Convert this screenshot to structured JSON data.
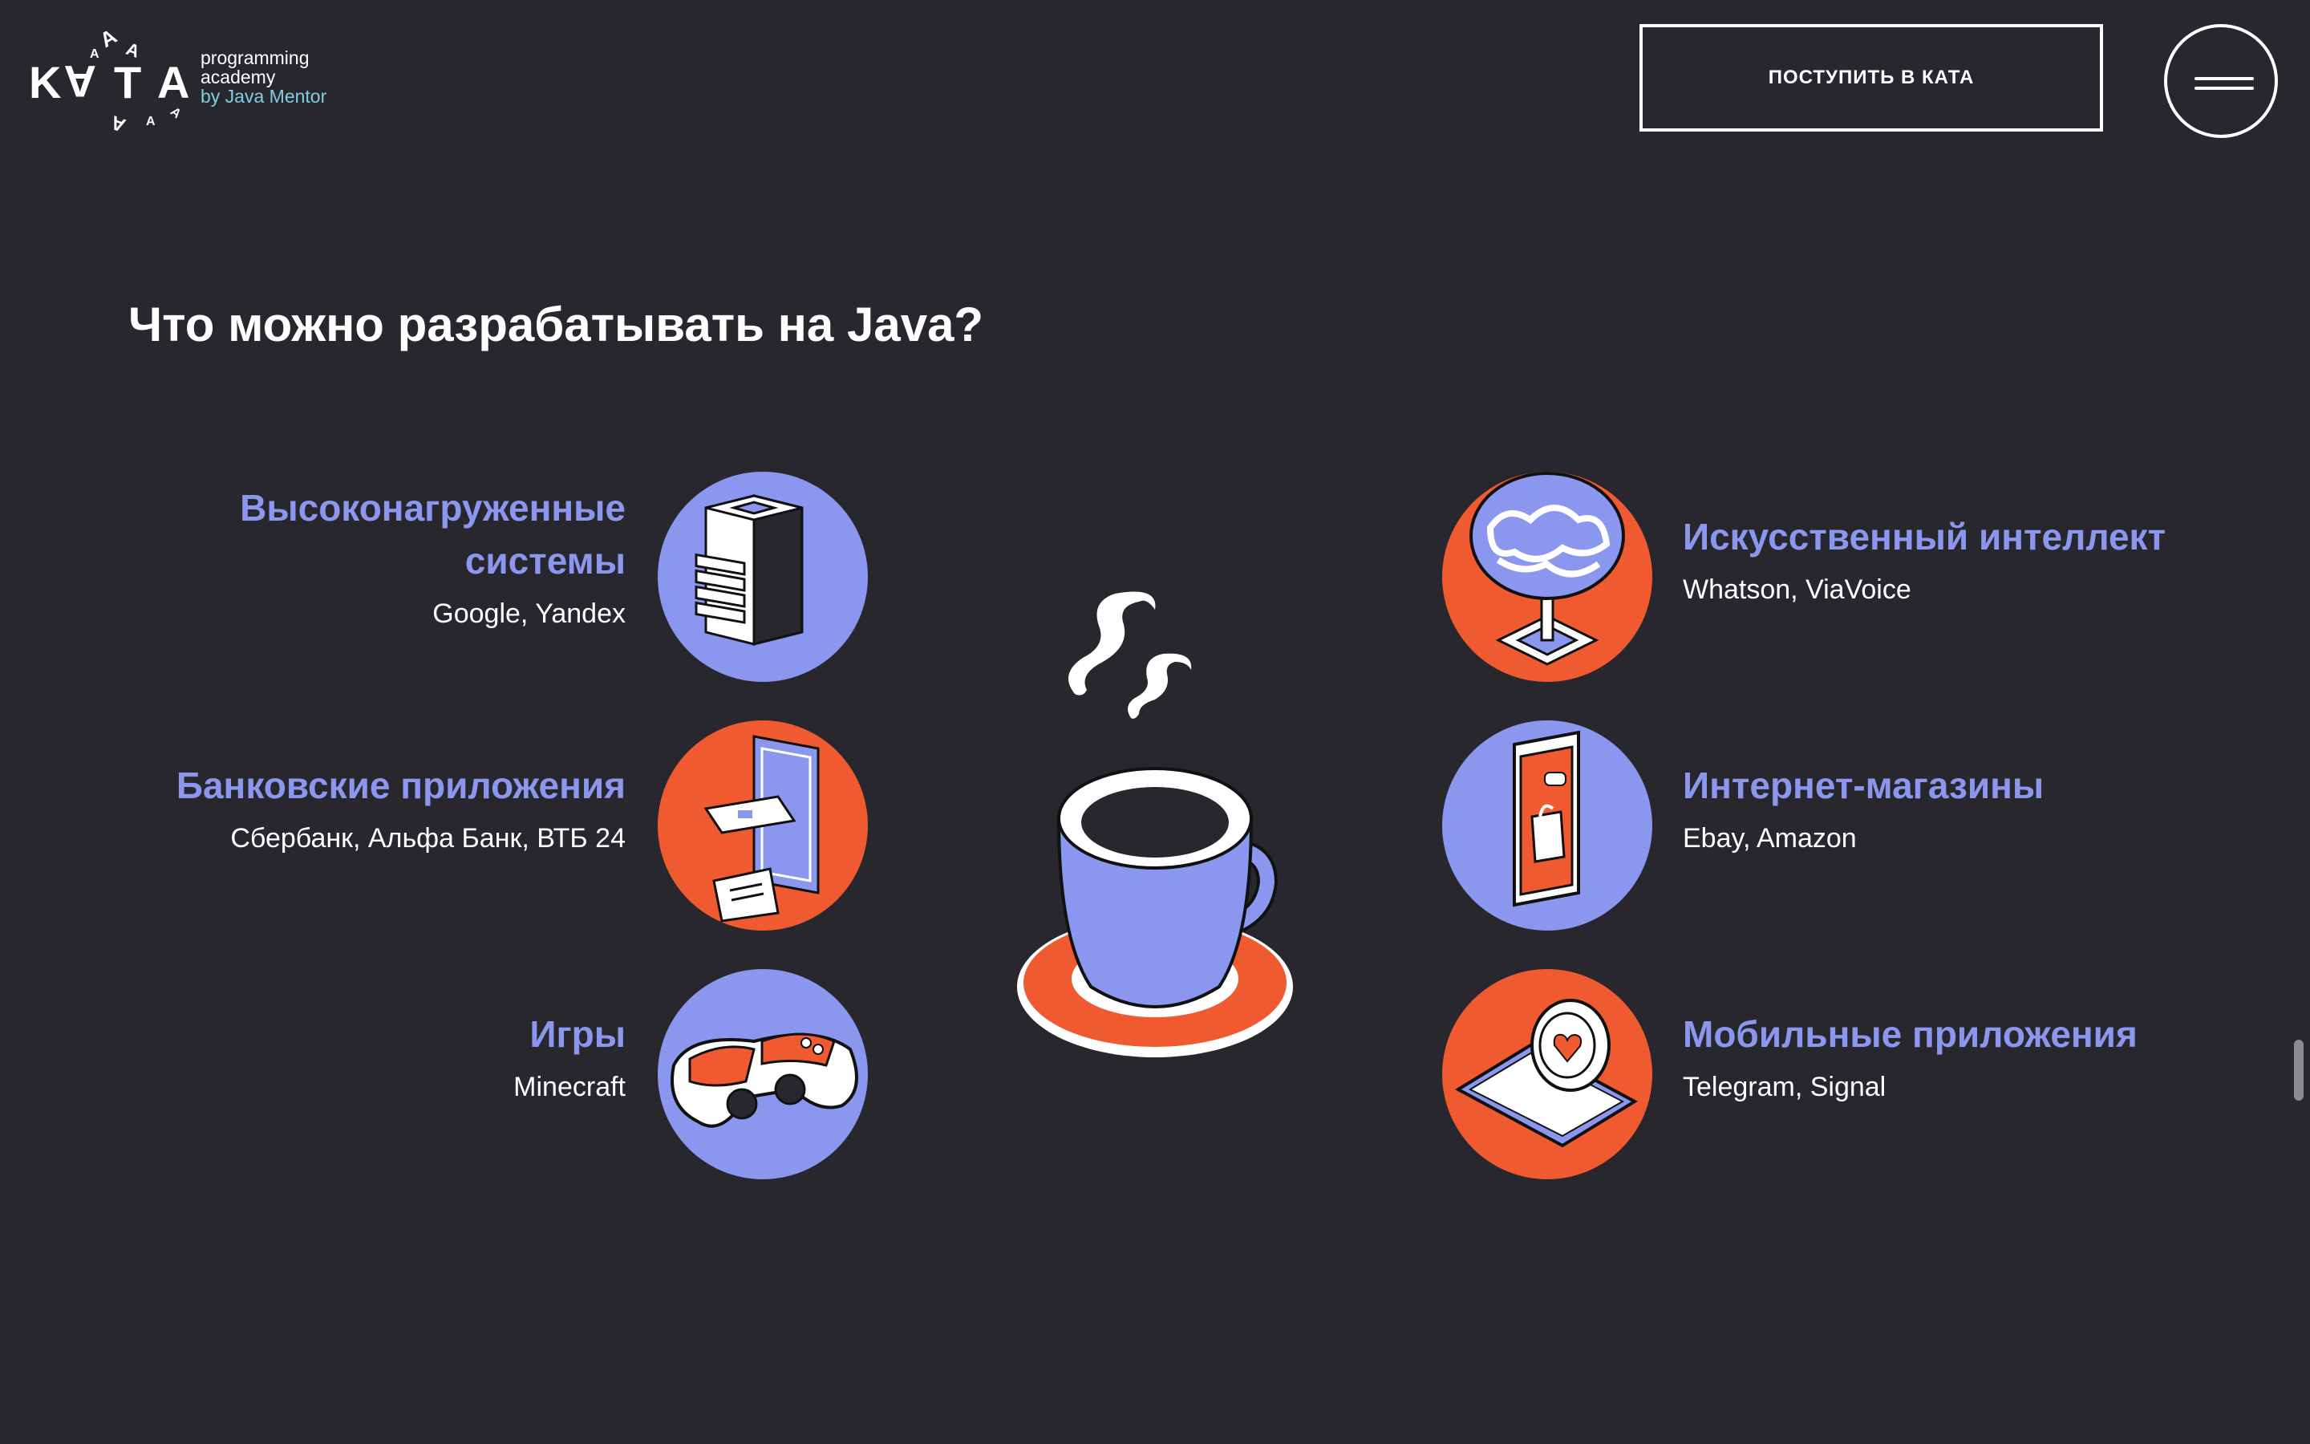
{
  "logo": {
    "wordmark": "KATA",
    "line1": "programming",
    "line2": "academy",
    "line3": "by Java Mentor"
  },
  "header": {
    "cta_label": "ПОСТУПИТЬ В КАТА"
  },
  "section": {
    "title": "Что можно разрабатывать на Java?"
  },
  "items_left": [
    {
      "title_line1": "Высоконагруженные",
      "title_line2": "системы",
      "sub": "Google, Yandex",
      "icon": "server-icon",
      "color": "#8b97ee"
    },
    {
      "title": "Банковские приложения",
      "sub": "Сбербанк, Альфа Банк, ВТБ 24",
      "icon": "banking-phone-icon",
      "color": "#ef5a30"
    },
    {
      "title": "Игры",
      "sub": "Minecraft",
      "icon": "gamepad-icon",
      "color": "#8b97ee"
    }
  ],
  "items_right": [
    {
      "title": "Искусственный интеллект",
      "sub": "Whatson, ViaVoice",
      "icon": "brain-icon",
      "color": "#ef5a30"
    },
    {
      "title": "Интернет-магазины",
      "sub": "Ebay, Amazon",
      "icon": "shop-phone-icon",
      "color": "#8b97ee"
    },
    {
      "title": "Мобильные приложения",
      "sub": "Telegram, Signal",
      "icon": "mobile-chat-icon",
      "color": "#ef5a30"
    }
  ],
  "colors": {
    "background": "#28272d",
    "accent_blue": "#8b97ee",
    "accent_orange": "#ef5a30"
  }
}
